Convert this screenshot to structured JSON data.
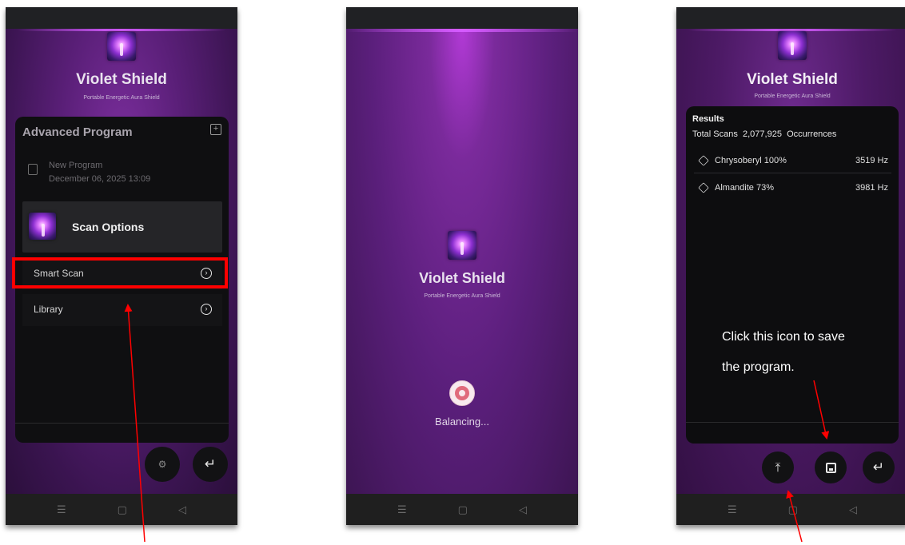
{
  "app": {
    "title": "Violet Shield",
    "subtitle": "Portable Energetic Aura Shield"
  },
  "screen1": {
    "card_title": "Advanced Program",
    "program_name": "New Program",
    "program_date": "December 06, 2025 13:09",
    "scan_options_label": "Scan Options",
    "options": [
      {
        "label": "Smart Scan",
        "icon": "arrow-circle-right-icon",
        "highlighted": true
      },
      {
        "label": "Library",
        "icon": "arrow-circle-right-icon",
        "highlighted": false
      }
    ]
  },
  "screen2": {
    "status": "Balancing..."
  },
  "screen3": {
    "results_heading": "Results",
    "total_scans_label": "Total Scans",
    "total_scans_value": "2,077,925",
    "occurrences_label": "Occurrences",
    "results": [
      {
        "name": "Chrysoberyl 100%",
        "freq": "3519 Hz"
      },
      {
        "name": "Almandite 73%",
        "freq": "3981 Hz"
      }
    ],
    "annotation": "Click this icon to save the program.",
    "annotation_line1": "Click this icon to save",
    "annotation_line2": "the program."
  },
  "navbar": {
    "icons": [
      "menu-icon",
      "home-icon",
      "back-triangle-icon"
    ]
  },
  "colors": {
    "accent_red": "#ff0000",
    "card": "#0d0d0f",
    "purple": "#5a1f78"
  }
}
